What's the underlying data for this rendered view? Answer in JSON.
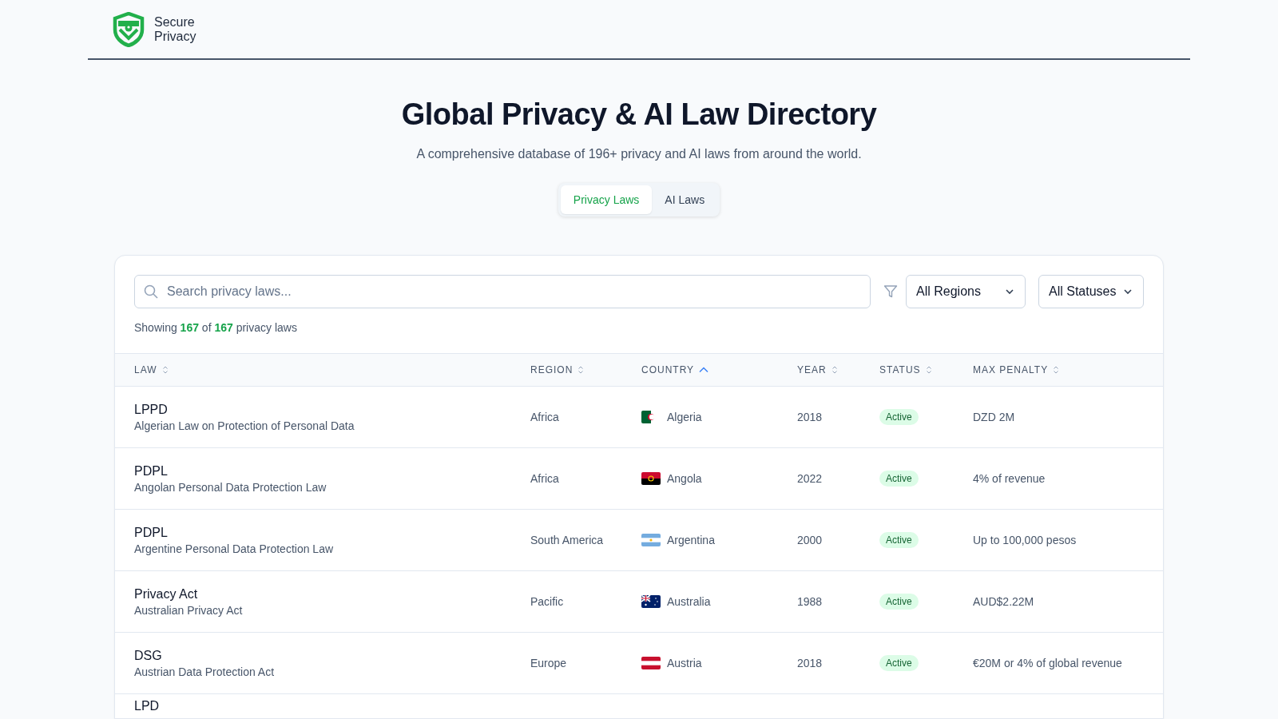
{
  "brand": {
    "line1": "Secure",
    "line2": "Privacy"
  },
  "hero": {
    "title": "Global Privacy & AI Law Directory",
    "subtitle": "A comprehensive database of 196+ privacy and AI laws from around the world."
  },
  "tabs": [
    {
      "label": "Privacy Laws",
      "selected": true
    },
    {
      "label": "AI Laws",
      "selected": false
    }
  ],
  "filters": {
    "search_placeholder": "Search privacy laws...",
    "region": "All Regions",
    "status": "All Statuses"
  },
  "summary": {
    "prefix": "Showing",
    "shown": "167",
    "middle": "of",
    "total": "167",
    "suffix": "privacy laws"
  },
  "table": {
    "columns": [
      {
        "label": "LAW",
        "kind": "sortable"
      },
      {
        "label": "REGION",
        "kind": "sortable"
      },
      {
        "label": "COUNTRY",
        "kind": "ascending"
      },
      {
        "label": "YEAR",
        "kind": "sortable"
      },
      {
        "label": "STATUS",
        "kind": "sortable"
      },
      {
        "label": "MAX PENALTY",
        "kind": "sortable"
      }
    ],
    "rows": [
      {
        "code": "LPPD",
        "name": "Algerian Law on Protection of Personal Data",
        "region": "Africa",
        "kind": "algeria",
        "country": "Algeria",
        "year": "2018",
        "status": "Active",
        "penalty": "DZD 2M"
      },
      {
        "code": "PDPL",
        "name": "Angolan Personal Data Protection Law",
        "region": "Africa",
        "kind": "angola",
        "country": "Angola",
        "year": "2022",
        "status": "Active",
        "penalty": "4% of revenue"
      },
      {
        "code": "PDPL",
        "name": "Argentine Personal Data Protection Law",
        "region": "South America",
        "kind": "argentina",
        "country": "Argentina",
        "year": "2000",
        "status": "Active",
        "penalty": "Up to 100,000 pesos"
      },
      {
        "code": "Privacy Act",
        "name": "Australian Privacy Act",
        "region": "Pacific",
        "kind": "australia",
        "country": "Australia",
        "year": "1988",
        "status": "Active",
        "penalty": "AUD$2.22M"
      },
      {
        "code": "DSG",
        "name": "Austrian Data Protection Act",
        "region": "Europe",
        "kind": "austria",
        "country": "Austria",
        "year": "2018",
        "status": "Active",
        "penalty": "€20M or 4% of global revenue"
      },
      {
        "code": "LPD"
      }
    ]
  }
}
